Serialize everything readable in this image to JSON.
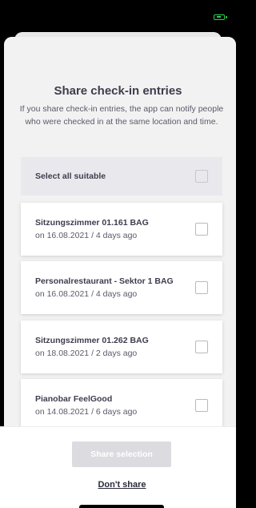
{
  "colors": {
    "battery": "#27d34d",
    "disabled_button": "#dcdce0",
    "text_dark": "#3d3d4e"
  },
  "status_bar": {
    "battery_icon": "battery-icon"
  },
  "dialog": {
    "title": "Share check-in entries",
    "description": "If you share check-in entries, the app can notify people who were checked in at the same location and time."
  },
  "select_all": {
    "label": "Select all suitable",
    "checked": false
  },
  "entries": [
    {
      "name": "Sitzungszimmer 01.161 BAG",
      "date": "on 16.08.2021 / 4 days ago",
      "checked": false
    },
    {
      "name": "Personalrestaurant - Sektor 1 BAG",
      "date": "on 16.08.2021 / 4 days ago",
      "checked": false
    },
    {
      "name": "Sitzungszimmer 01.262 BAG",
      "date": "on 18.08.2021 / 2 days ago",
      "checked": false
    },
    {
      "name": "Pianobar FeelGood",
      "date": "on 14.08.2021 / 6 days ago",
      "checked": false
    }
  ],
  "footer": {
    "share_label": "Share selection",
    "dont_share_label": "Don't share"
  }
}
